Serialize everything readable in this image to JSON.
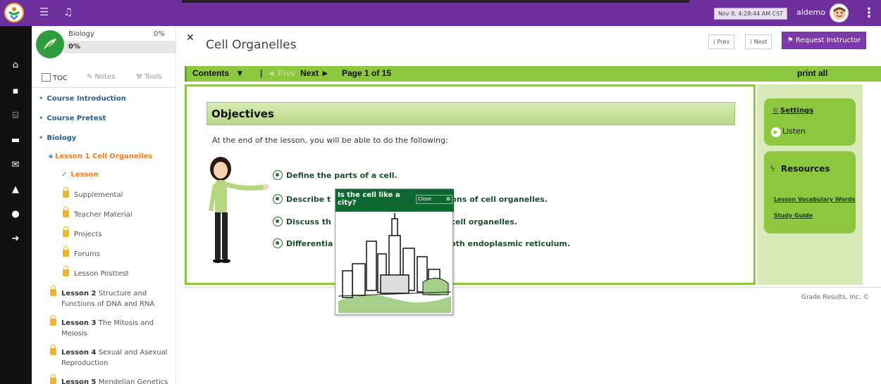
{
  "topbar": {
    "datetime": "Nov 9, 4:28:44 AM CST",
    "username": "aldemo"
  },
  "sidebar": {
    "course_name": "Biology",
    "course_percent": "0%",
    "progress_label": "0%",
    "progress_value": 0,
    "tabs": {
      "toc": "TOC",
      "notes": "Notes",
      "tools": "Tools"
    },
    "toc": {
      "course_intro": "Course Introduction",
      "course_pretest": "Course Pretest",
      "biology": "Biology",
      "lesson1": "Lesson 1 Cell Organelles",
      "lesson": "Lesson",
      "supplemental": "Supplemental",
      "teacher_material": "Teacher Material",
      "projects": "Projects",
      "forums": "Forums",
      "lesson_posttest": "Lesson Posttest",
      "lesson2_prefix": "Lesson 2",
      "lesson2_l1": "Structure and",
      "lesson2_l2": "Functions of DNA and RNA",
      "lesson3_prefix": "Lesson 3",
      "lesson3_l1": "The Mitosis and",
      "lesson3_l2": "Meiosis",
      "lesson4_prefix": "Lesson 4",
      "lesson4_l1": "Sexual and Asexual",
      "lesson4_l2": "Reproduction",
      "lesson5_prefix": "Lesson 5",
      "lesson5_l1": "Mendelian Genetics"
    }
  },
  "page": {
    "title": "Cell Organelles",
    "prev": "⟨ Prev",
    "next": "⟩ Next",
    "request": "Request Instructor"
  },
  "navbar": {
    "contents": "Contents",
    "prev": "◄ Prev",
    "next": "Next ►",
    "page": "Page 1 of 15",
    "print_all": "print all"
  },
  "lesson": {
    "objectives_title": "Objectives",
    "intro": "At the end of the lesson, you will be able to do the following:",
    "objectives": {
      "o1": "Define the parts of a cell.",
      "o2": "Describe t",
      "o2_tail": "tions of cell organelles.",
      "o3": "Discuss th",
      "o3_tail": "l cell organelles.",
      "o4": "Differentia",
      "o4_tail": "ooth endoplasmic reticulum."
    }
  },
  "right_panel": {
    "settings": "Settings",
    "listen": "Listen",
    "resources": "Resources",
    "vocab": "Lesson Vocabulary Words",
    "study_guide": "Study Guide"
  },
  "footer": {
    "text": "Grade Results, Inc. ©"
  },
  "popup": {
    "title": "Is the cell like a city?",
    "close": "Close"
  },
  "colors": {
    "purple": "#6d2f9c",
    "green": "#8dc63f",
    "dark_green": "#0e6930",
    "orange": "#f47c20"
  }
}
